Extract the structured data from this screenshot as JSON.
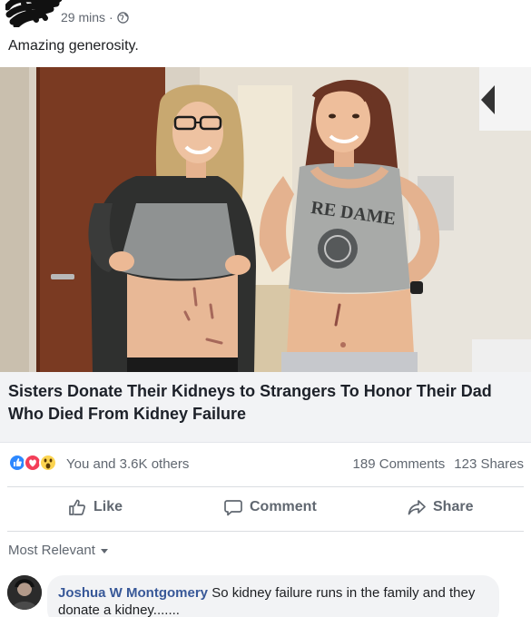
{
  "post": {
    "time": "29 mins",
    "separator": "·",
    "caption": "Amazing generosity."
  },
  "link": {
    "headline": "Sisters Donate Their Kidneys to Strangers To Honor Their Dad Who Died From Kidney Failure",
    "shirt_text": "RE DAME"
  },
  "stats": {
    "reactions_text": "You and 3.6K others",
    "comments": "189 Comments",
    "shares": "123 Shares"
  },
  "actions": {
    "like": "Like",
    "comment": "Comment",
    "share": "Share"
  },
  "comments_section": {
    "sort_label": "Most Relevant",
    "comment": {
      "author": "Joshua W Montgomery",
      "text": "So kidney failure runs in the family and they donate a kidney......."
    }
  },
  "colors": {
    "like_blue": "#2d88ff",
    "love_red": "#f33e58",
    "wow_yellow": "#fcd450",
    "link_gray": "#f2f3f5",
    "author_blue": "#385898"
  },
  "icons": [
    "globe-icon",
    "like-reaction-icon",
    "love-reaction-icon",
    "wow-reaction-icon",
    "thumbs-up-icon",
    "comment-icon",
    "share-icon",
    "caret-down-icon"
  ]
}
